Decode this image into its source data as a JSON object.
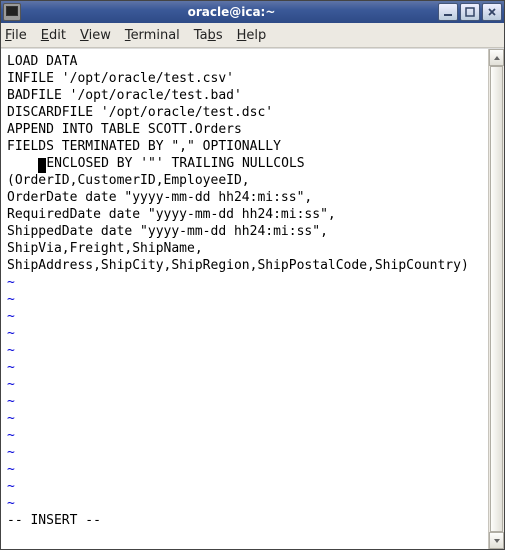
{
  "titlebar": {
    "title": "oracle@ica:~"
  },
  "menubar": {
    "file": "File",
    "edit": "Edit",
    "view": "View",
    "terminal": "Terminal",
    "tabs": "Tabs",
    "help": "Help"
  },
  "terminal": {
    "lines": [
      "LOAD DATA",
      "INFILE '/opt/oracle/test.csv'",
      "BADFILE '/opt/oracle/test.bad'",
      "DISCARDFILE '/opt/oracle/test.dsc'",
      "APPEND INTO TABLE SCOTT.Orders",
      "FIELDS TERMINATED BY \",\" OPTIONALLY"
    ],
    "cursor_line_prefix": "    ",
    "cursor_line_suffix": "ENCLOSED BY '\"' TRAILING NULLCOLS",
    "lines_after_cursor": [
      "(OrderID,CustomerID,EmployeeID,",
      "OrderDate date \"yyyy-mm-dd hh24:mi:ss\",",
      "RequiredDate date \"yyyy-mm-dd hh24:mi:ss\",",
      "ShippedDate date \"yyyy-mm-dd hh24:mi:ss\",",
      "ShipVia,Freight,ShipName,",
      "ShipAddress,ShipCity,ShipRegion,ShipPostalCode,ShipCountry)"
    ],
    "tilde_count": 14,
    "status": "-- INSERT --"
  }
}
